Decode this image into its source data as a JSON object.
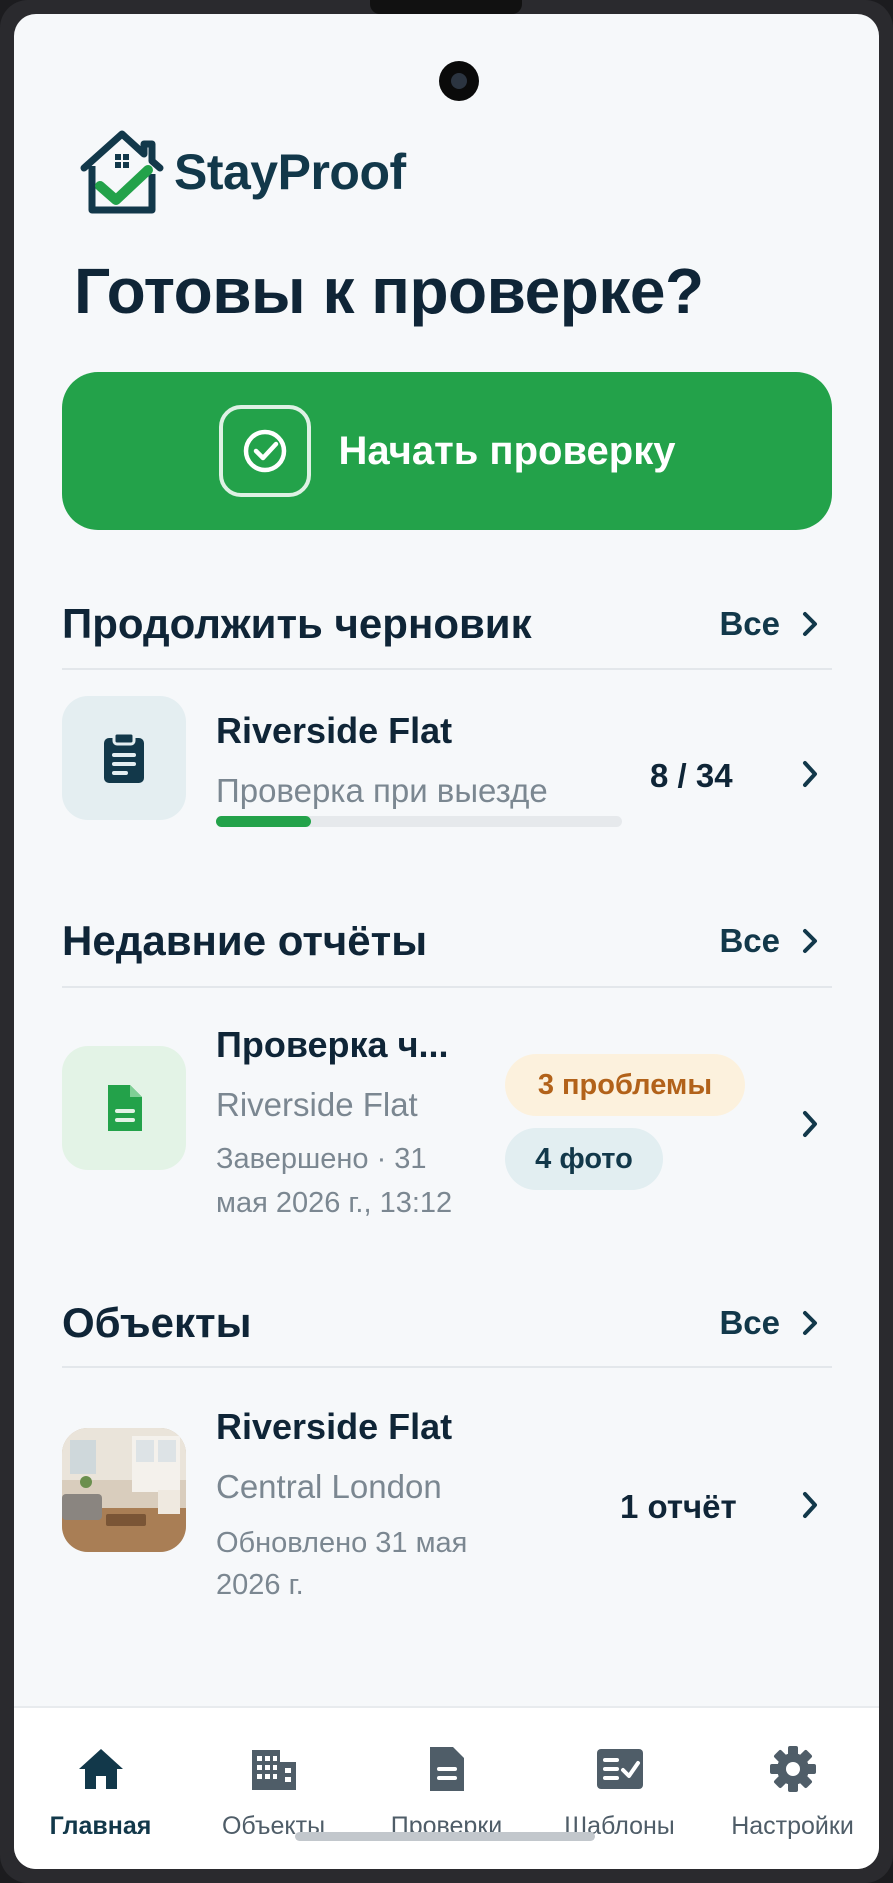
{
  "app": {
    "name": "StayProof"
  },
  "page": {
    "title": "Готовы к проверке?"
  },
  "start_button": {
    "label": "Начать проверку"
  },
  "drafts": {
    "title": "Продолжить черновик",
    "all_label": "Все",
    "item": {
      "title": "Riverside Flat",
      "subtitle": "Проверка при выезде",
      "progress_text": "8 / 34",
      "progress_fraction": 0.235
    }
  },
  "reports": {
    "title": "Недавние отчёты",
    "all_label": "Все",
    "item": {
      "title": "Проверка ч...",
      "subtitle": "Riverside Flat",
      "meta_line1": "Завершено · 31",
      "meta_line2": "мая 2026 г., 13:12",
      "issues_badge": "3 проблемы",
      "photos_badge": "4 фото"
    }
  },
  "properties": {
    "title": "Объекты",
    "all_label": "Все",
    "item": {
      "title": "Riverside Flat",
      "subtitle": "Central London",
      "meta_line1": "Обновлено 31 мая",
      "meta_line2": "2026 г.",
      "count": "1 отчёт"
    }
  },
  "nav": [
    {
      "label": "Главная",
      "icon": "home-icon",
      "active": true
    },
    {
      "label": "Объекты",
      "icon": "building-icon",
      "active": false
    },
    {
      "label": "Проверки",
      "icon": "document-icon",
      "active": false
    },
    {
      "label": "Шаблоны",
      "icon": "checklist-icon",
      "active": false
    },
    {
      "label": "Настройки",
      "icon": "gear-icon",
      "active": false
    }
  ],
  "colors": {
    "primary": "#23a24a",
    "navy": "#12384a",
    "warn": "#b2621a"
  }
}
